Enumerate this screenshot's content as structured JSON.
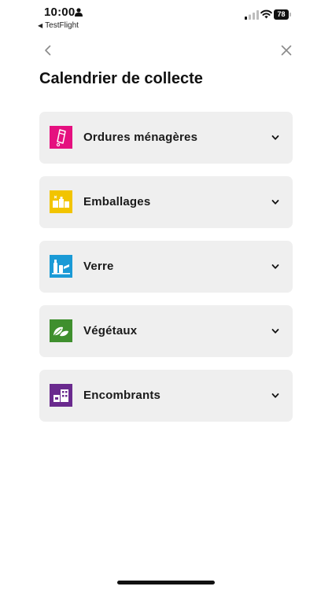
{
  "status_bar": {
    "time": "10:00",
    "back_app_label": "TestFlight",
    "battery_level": "78"
  },
  "header": {
    "title": "Calendrier de collecte"
  },
  "categories": [
    {
      "label": "Ordures ménagères",
      "icon": "trash-bag-icon",
      "color": "#e5107f"
    },
    {
      "label": "Emballages",
      "icon": "packaging-icon",
      "color": "#f2c400"
    },
    {
      "label": "Verre",
      "icon": "glass-bottles-icon",
      "color": "#1a9ad6"
    },
    {
      "label": "Végétaux",
      "icon": "leaves-icon",
      "color": "#3f8f2e"
    },
    {
      "label": "Encombrants",
      "icon": "bulky-items-icon",
      "color": "#6a2a8e"
    }
  ]
}
